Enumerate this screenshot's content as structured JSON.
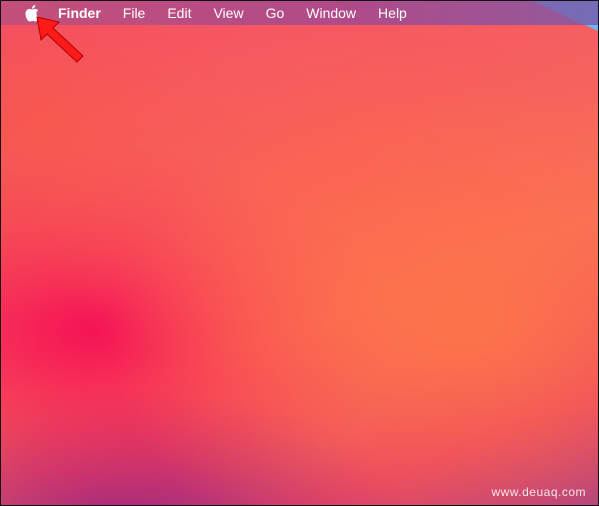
{
  "menubar": {
    "apple_icon": "apple-icon",
    "app_name": "Finder",
    "items": [
      {
        "label": "File"
      },
      {
        "label": "Edit"
      },
      {
        "label": "View"
      },
      {
        "label": "Go"
      },
      {
        "label": "Window"
      },
      {
        "label": "Help"
      }
    ]
  },
  "annotation": {
    "arrow_icon": "red-arrow-icon",
    "arrow_color": "#ff1a1a"
  },
  "watermark": {
    "text": "www.deuaq.com"
  },
  "colors": {
    "wallpaper_primary": "#f56060",
    "wallpaper_accent": "#f50f55",
    "corner_blue": "#6fb3ea"
  }
}
